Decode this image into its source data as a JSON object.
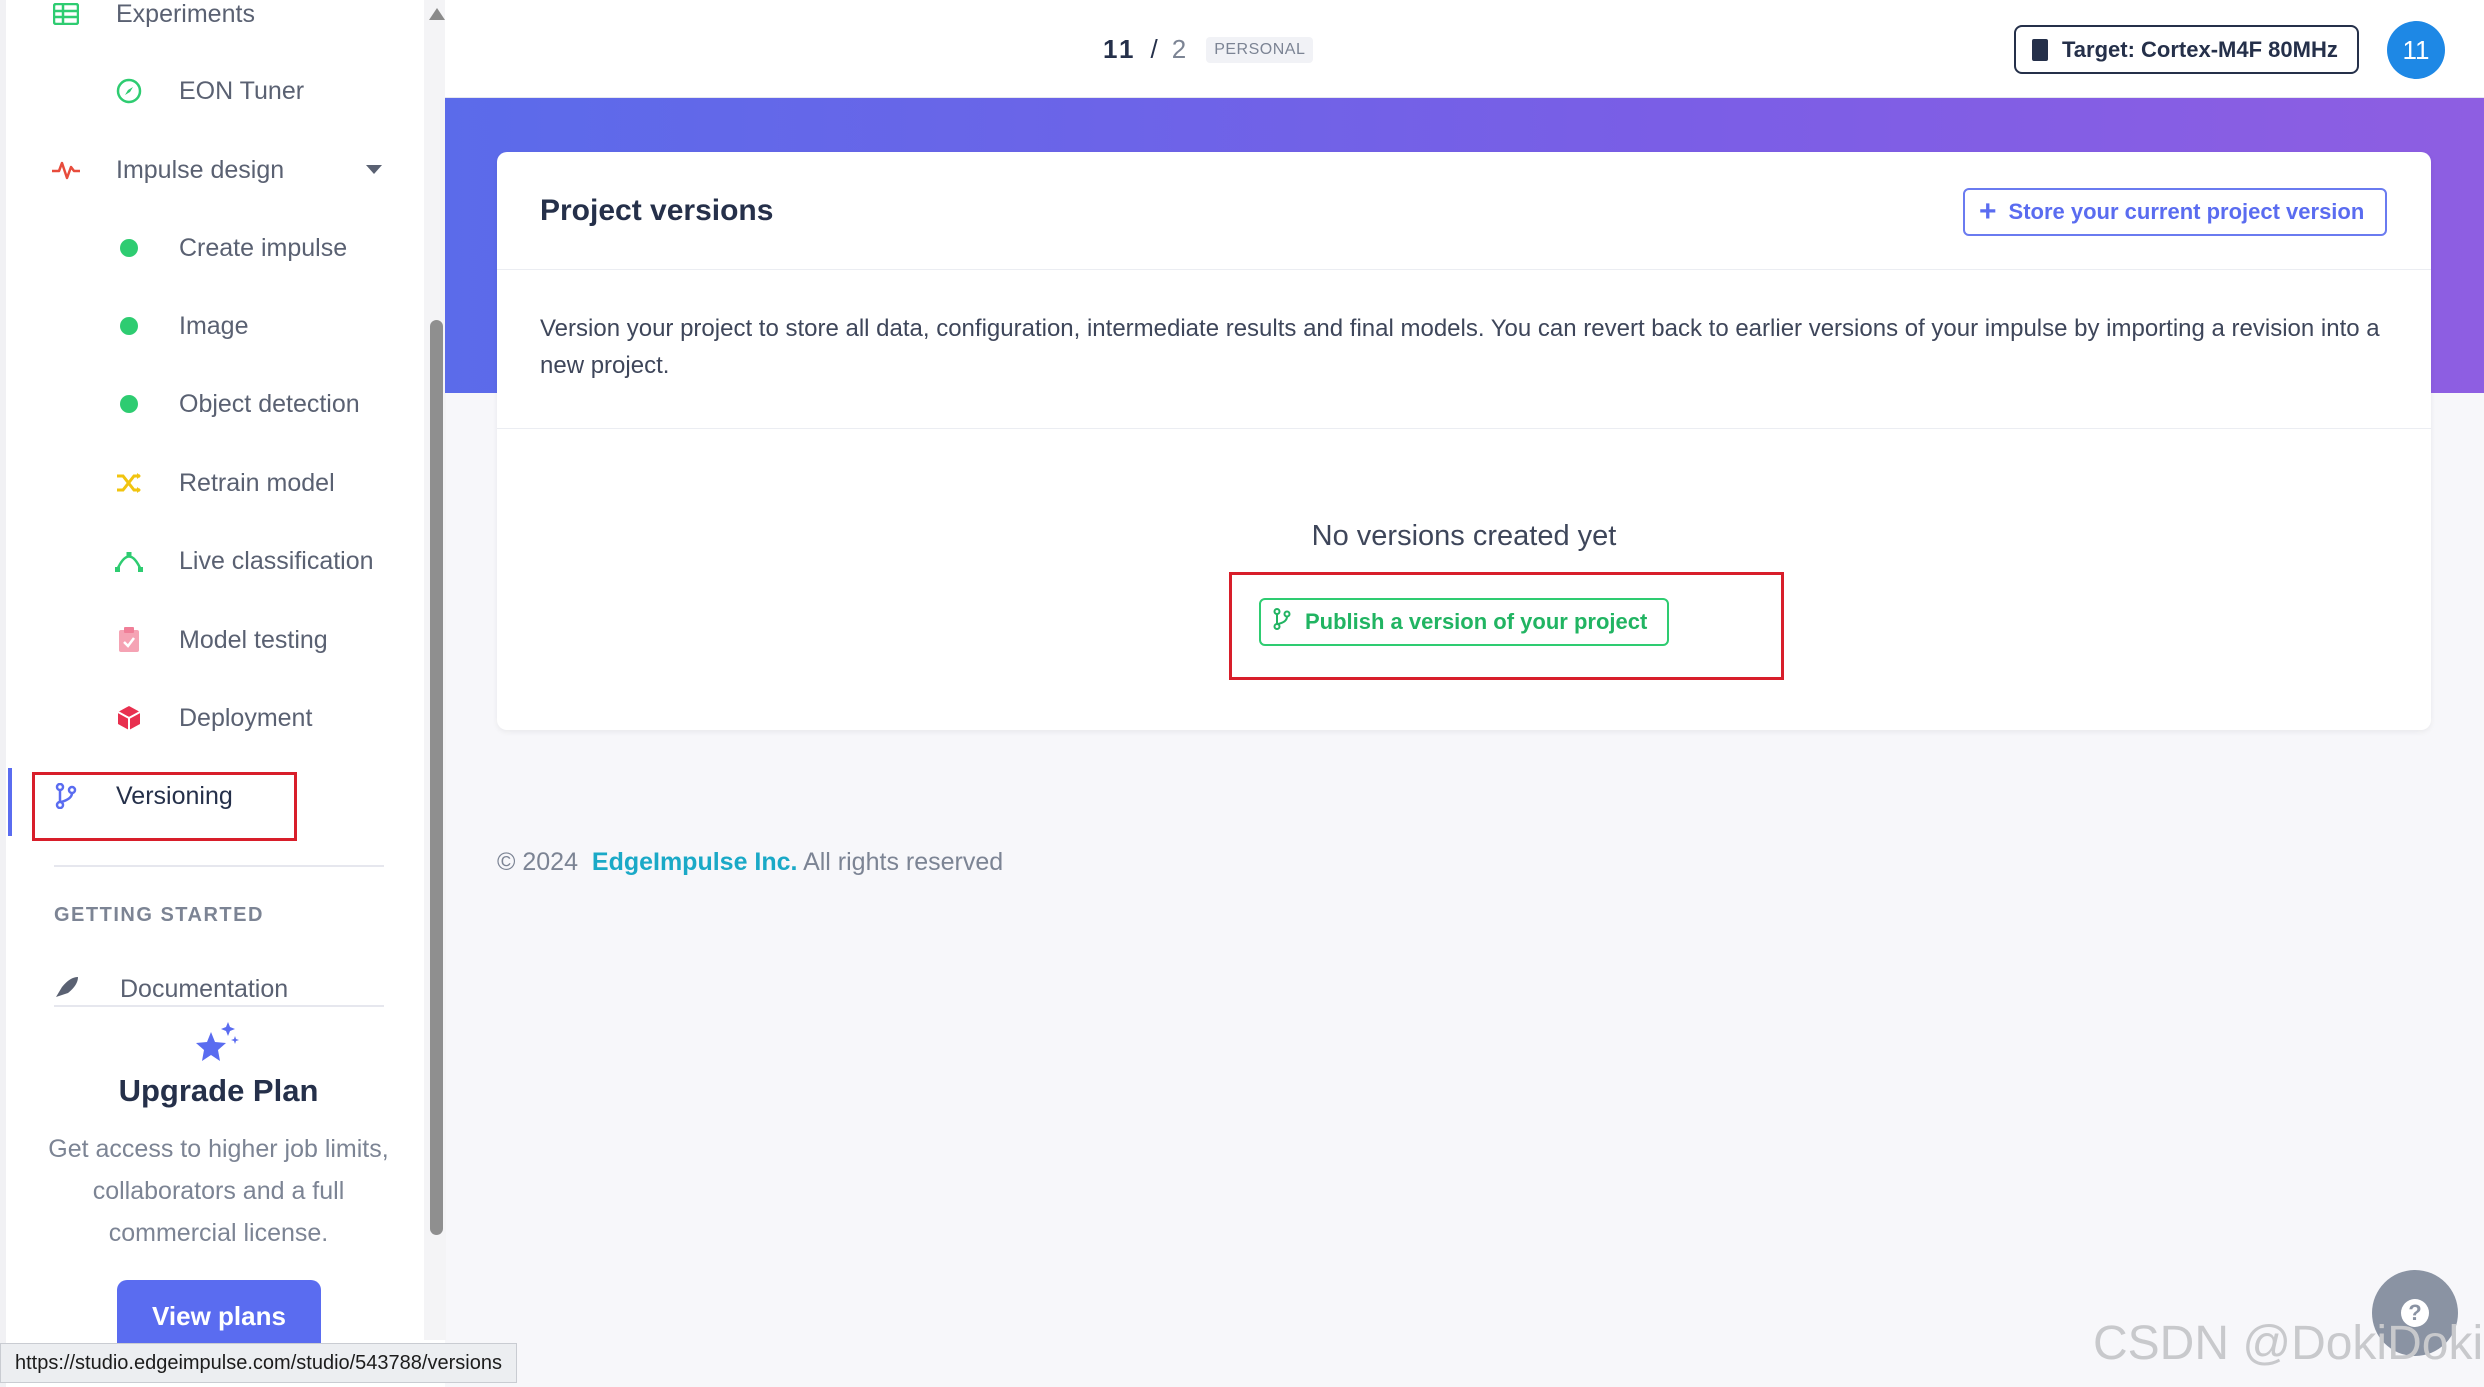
{
  "sidebar": {
    "experiments_label": "Experiments",
    "eon_tuner_label": "EON Tuner",
    "impulse_design_label": "Impulse design",
    "items": [
      {
        "label": "Create impulse"
      },
      {
        "label": "Image"
      },
      {
        "label": "Object detection"
      },
      {
        "label": "Retrain model"
      },
      {
        "label": "Live classification"
      },
      {
        "label": "Model testing"
      },
      {
        "label": "Deployment"
      }
    ],
    "versioning_label": "Versioning",
    "getting_started_label": "GETTING STARTED",
    "documentation_label": "Documentation",
    "upgrade": {
      "title": "Upgrade Plan",
      "text": "Get access to higher job limits, collaborators and a full commercial license.",
      "button": "View plans"
    }
  },
  "statusbar": {
    "url": "https://studio.edgeimpulse.com/studio/543788/versions"
  },
  "topbar": {
    "counter_current": "11",
    "counter_sep": "/",
    "counter_total": "2",
    "badge": "PERSONAL",
    "target_label": "Target: Cortex-M4F 80MHz",
    "avatar": "11"
  },
  "main": {
    "card_title": "Project versions",
    "store_button": "Store your current project version",
    "description": "Version your project to store all data, configuration, intermediate results and final models. You can revert back to earlier versions of your impulse by importing a revision into a new project.",
    "empty_message": "No versions created yet",
    "publish_button": "Publish a version of your project"
  },
  "footer": {
    "copyright": "© 2024",
    "company": "EdgeImpulse Inc.",
    "rights": "All rights reserved"
  },
  "watermark": "CSDN @DokiDoki`",
  "colors": {
    "accent": "#5a6cf0",
    "green": "#2ecc71",
    "highlight": "#d81e2a"
  }
}
